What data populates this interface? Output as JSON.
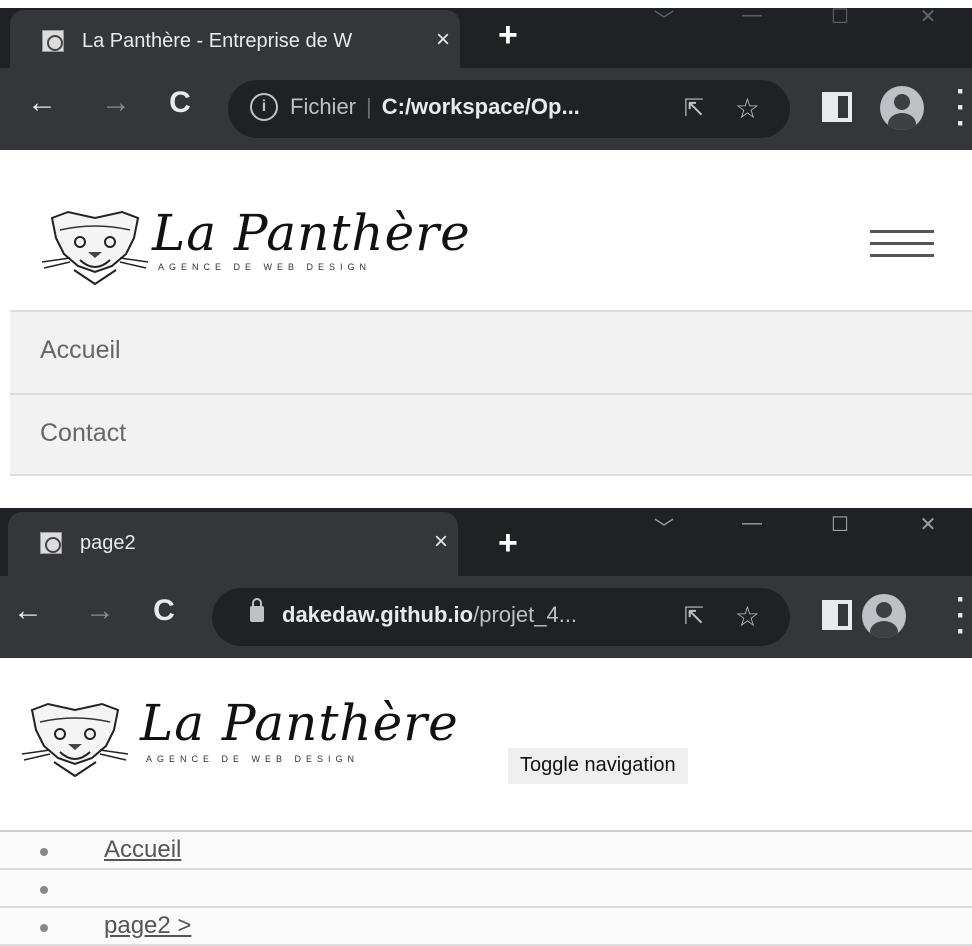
{
  "screenshot1": {
    "tab": {
      "title": "La Panthère - Entreprise de W",
      "close": "×"
    },
    "new_tab": "+",
    "window_controls": [
      "﹀",
      "—",
      "☐",
      "✕"
    ],
    "nav": {
      "back": "←",
      "forward": "→",
      "reload": "C"
    },
    "omnibox": {
      "info": "i",
      "scheme": "Fichier",
      "url": "C:/workspace/Op..."
    },
    "brand": {
      "name": "La Panthère",
      "tagline": "AGENCE DE WEB DESIGN"
    },
    "menu": [
      "Accueil",
      "Contact"
    ]
  },
  "screenshot2": {
    "tab": {
      "title": "page2",
      "close": "×"
    },
    "new_tab": "+",
    "window_controls": [
      "﹀",
      "—",
      "☐",
      "✕"
    ],
    "nav": {
      "back": "←",
      "forward": "→",
      "reload": "C"
    },
    "omnibox": {
      "url_host": "dakedaw.github.io",
      "url_path": "/projet_4..."
    },
    "brand": {
      "name": "La Panthère",
      "tagline": "AGENCE DE WEB DESIGN"
    },
    "toggle_label": "Toggle navigation",
    "list": [
      "Accueil",
      "",
      "page2 >"
    ]
  },
  "icons": {
    "share": "share-icon",
    "star": "bookmark-star-icon",
    "side_panel": "side-panel-icon",
    "profile": "profile-avatar-icon",
    "menu": "more-vert-icon"
  },
  "colors": {
    "chrome_bg": "#202124",
    "chrome_toolbar": "#35363a",
    "menu_bg": "#f2f2f2",
    "text_muted": "#666666"
  }
}
